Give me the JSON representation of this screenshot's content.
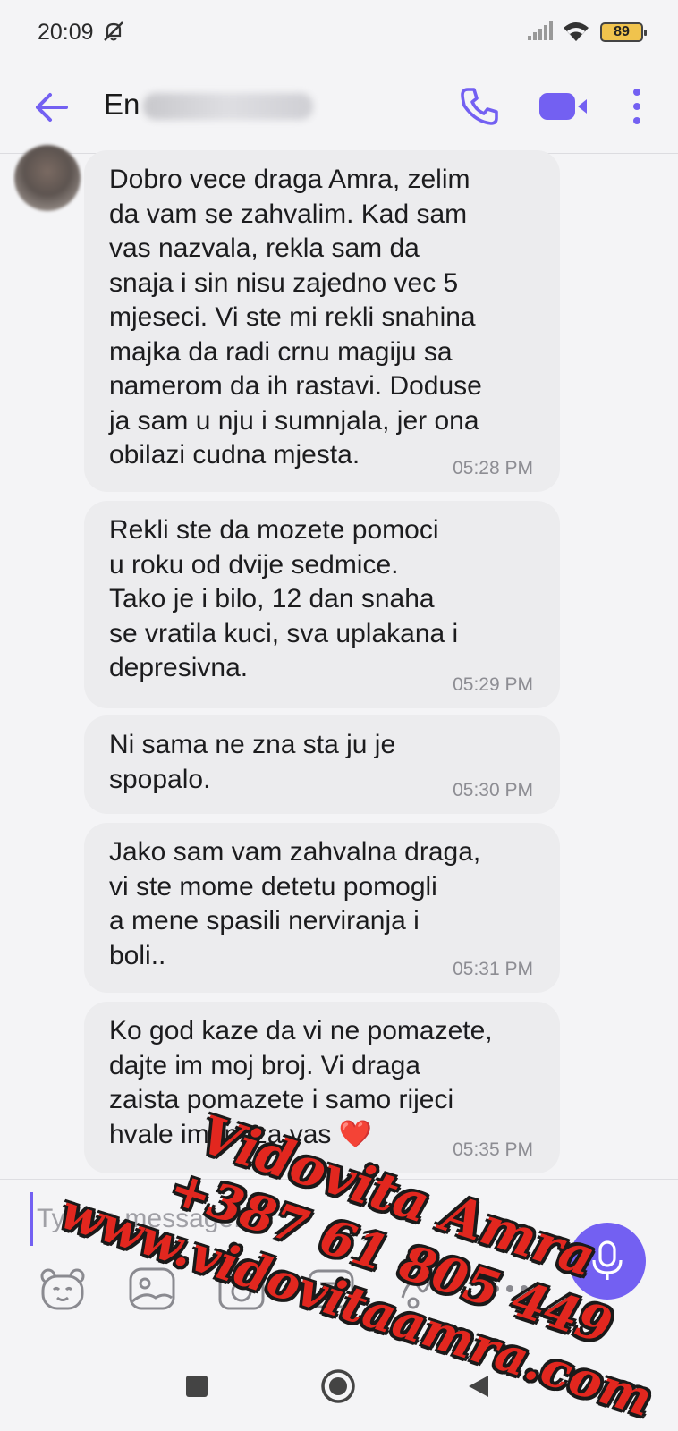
{
  "status_bar": {
    "time": "20:09",
    "battery": "89",
    "icons": [
      "dnd-icon",
      "signal-icon",
      "wifi-icon",
      "battery-icon"
    ]
  },
  "header": {
    "contact_name": "En",
    "contact_name_blurred": true,
    "icons": [
      "back-arrow-icon",
      "phone-icon",
      "video-camera-icon",
      "more-vert-icon"
    ],
    "accent_color": "#7360f2"
  },
  "messages": [
    {
      "text": "Dobro vece draga Amra, zelim\nda vam se zahvalim. Kad sam\nvas nazvala, rekla sam da\nsnaja i sin nisu zajedno vec 5\nmjeseci. Vi ste mi rekli snahina\nmajka da radi crnu magiju sa\nnamerom da ih rastavi. Doduse\nja sam u nju i sumnjala, jer ona\nobilazi cudna mjesta.",
      "time": "05:28 PM"
    },
    {
      "text": "Rekli ste da mozete pomoci\nu roku od dvije sedmice.\nTako je i bilo, 12 dan snaha\nse vratila kuci, sva uplakana i\ndepresivna.",
      "time": "05:29 PM"
    },
    {
      "text": "Ni sama ne zna sta ju je\nspopalo.",
      "time": "05:30 PM"
    },
    {
      "text": "Jako sam vam zahvalna draga,\nvi ste mome detetu pomogli\na mene spasili nerviranja i\nboli..",
      "time": "05:31 PM"
    },
    {
      "text": "Ko god kaze da vi ne pomazete,\ndajte im moj broj. Vi draga\nzaista pomazete i samo rijeci\nhvale imam za vas ❤️",
      "time": "05:35 PM"
    }
  ],
  "composer": {
    "placeholder": "Type a message...",
    "tools": [
      "sticker-bear-icon",
      "gallery-icon",
      "camera-icon",
      "doodle-icon",
      "more-horiz-icon"
    ],
    "mic_icon": "microphone-icon"
  },
  "nav": [
    "recents-square-icon",
    "home-circle-icon",
    "back-triangle-icon"
  ],
  "watermark": {
    "line1": "Vidovita Amra",
    "line2": "+387 61 805 449",
    "line3": "www.vidovitaamra.com",
    "color": "#e2271f"
  }
}
